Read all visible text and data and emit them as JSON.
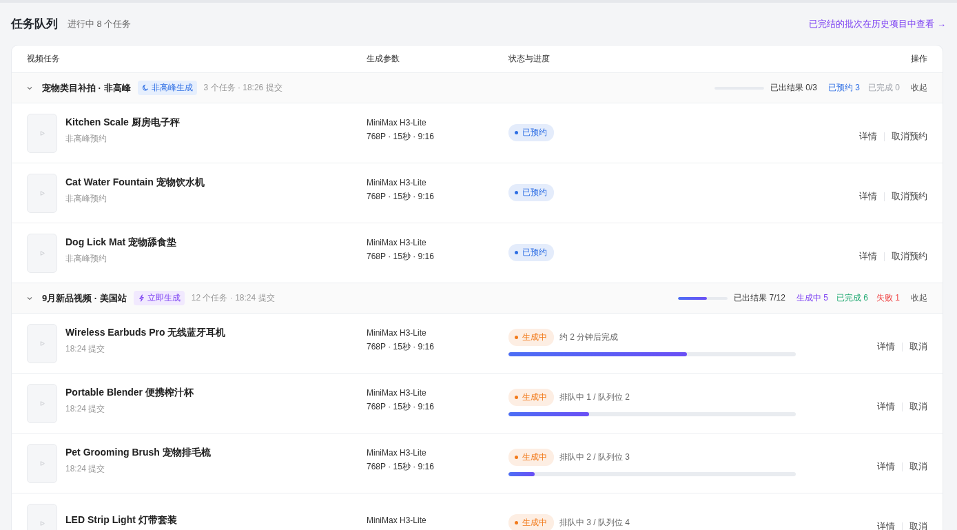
{
  "header": {
    "title": "任务队列",
    "subtitle": "进行中 8 个任务",
    "history_link": "已完结的批次在历史项目中查看 →"
  },
  "table": {
    "columns": [
      "视频任务",
      "生成参数",
      "状态与进度",
      "操作"
    ],
    "groups": [
      {
        "name": "宠物类目补拍 · 非高峰",
        "expanded": true,
        "tag": {
          "kind": "offpeak",
          "label": "非高峰生成"
        },
        "meta": "3 个任务 · 18:26 提交",
        "result": "已出结果 0/3",
        "stats": [
          {
            "text": "已预约 3",
            "color": "#2f6fe4"
          },
          {
            "text": "已完成 0",
            "color": "#a0a4ab"
          }
        ],
        "collapse": "收起",
        "tasks": [
          {
            "title": "Kitchen Scale 厨房电子秤",
            "sub": "非高峰预约",
            "model": "MiniMax H3-Lite",
            "params": "768P · 15秒 · 9:16",
            "status": {
              "kind": "scheduled",
              "label": "已预约"
            },
            "actions": [
              "详情",
              "取消预约"
            ]
          },
          {
            "title": "Cat Water Fountain 宠物饮水机",
            "sub": "非高峰预约",
            "model": "MiniMax H3-Lite",
            "params": "768P · 15秒 · 9:16",
            "status": {
              "kind": "scheduled",
              "label": "已预约"
            },
            "actions": [
              "详情",
              "取消预约"
            ]
          },
          {
            "title": "Dog Lick Mat 宠物舔食垫",
            "sub": "非高峰预约",
            "model": "MiniMax H3-Lite",
            "params": "768P · 15秒 · 9:16",
            "status": {
              "kind": "scheduled",
              "label": "已预约"
            },
            "actions": [
              "详情",
              "取消预约"
            ]
          }
        ]
      },
      {
        "name": "9月新品视频 · 美国站",
        "expanded": true,
        "tag": {
          "kind": "instant",
          "label": "立即生成"
        },
        "meta": "12 个任务 · 18:24 提交",
        "level": 0.58,
        "result": "已出结果 7/12",
        "stats": [
          {
            "text": "生成中 5",
            "color": "#7b3ff2"
          },
          {
            "text": "已完成 6",
            "color": "#1fa971"
          },
          {
            "text": "失败 1",
            "color": "#ef4444"
          }
        ],
        "collapse": "收起",
        "tasks": [
          {
            "title": "Wireless Earbuds Pro 无线蓝牙耳机",
            "sub": "18:24 提交",
            "model": "MiniMax H3-Lite",
            "params": "768P · 15秒 · 9:16",
            "status": {
              "kind": "generating",
              "label": "生成中"
            },
            "note": "约 2 分钟后完成",
            "level": 0.62,
            "actions": [
              "详情",
              "取消"
            ]
          },
          {
            "title": "Portable Blender 便携榨汁杯",
            "sub": "18:24 提交",
            "model": "MiniMax H3-Lite",
            "params": "768P · 15秒 · 9:16",
            "status": {
              "kind": "generating",
              "label": "生成中"
            },
            "note": "排队中 1 / 队列位 2",
            "level": 0.28,
            "actions": [
              "详情",
              "取消"
            ]
          },
          {
            "title": "Pet Grooming Brush 宠物排毛梳",
            "sub": "18:24 提交",
            "model": "MiniMax H3-Lite",
            "params": "768P · 15秒 · 9:16",
            "status": {
              "kind": "generating",
              "label": "生成中"
            },
            "note": "排队中 2 / 队列位 3",
            "level": 0.09,
            "actions": [
              "详情",
              "取消"
            ]
          },
          {
            "title": "LED Strip Light 灯带套装",
            "model": "MiniMax H3-Lite",
            "status": {
              "kind": "generating",
              "label": "生成中"
            },
            "note": "排队中 3 / 队列位 4",
            "actions": [
              "详情",
              "取消"
            ]
          }
        ]
      }
    ]
  }
}
